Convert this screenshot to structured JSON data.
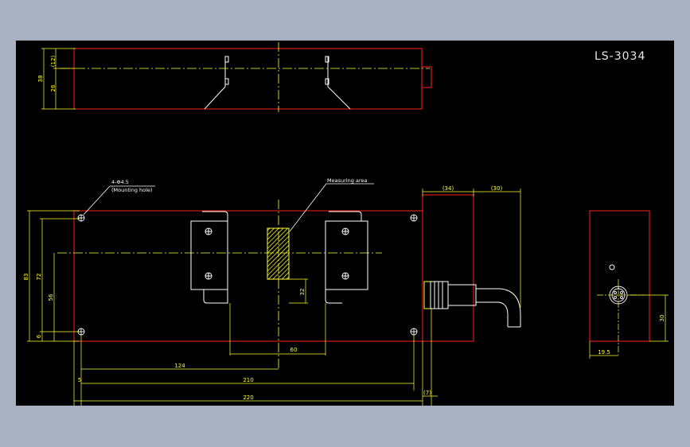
{
  "drawing": {
    "title": "LS-3034"
  },
  "top_view": {
    "dims": {
      "d12": "(12)",
      "d38": "38",
      "d26": "26"
    }
  },
  "front_view": {
    "dims": {
      "d83": "83",
      "d72": "72",
      "d56": "56",
      "d6": "6",
      "d32": "32",
      "d60": "60",
      "d124": "124",
      "d5": "5",
      "d210": "210",
      "d220": "220",
      "d7": "(7)",
      "d34": "(34)",
      "d30": "(30)"
    },
    "notes": {
      "hole": "4-Φ4.5",
      "hole_sub": "(Mounting hole)",
      "area": "Measuring area"
    }
  },
  "side_view": {
    "dims": {
      "d30": "30",
      "d19_5": "19.5"
    }
  },
  "colors": {
    "outline": "#ff2020",
    "dimension": "#ffff33",
    "centerline": "#ffff33",
    "bracket": "#ffffff",
    "background": "#000000",
    "frame": "#a7b1c1"
  }
}
